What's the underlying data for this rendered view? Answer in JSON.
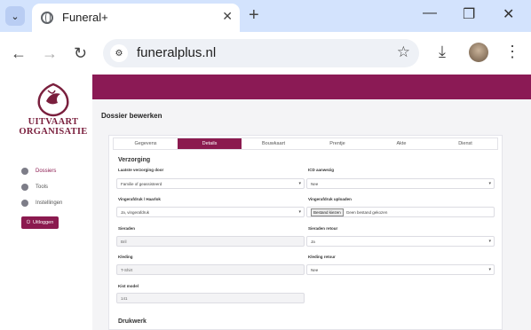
{
  "browser": {
    "tab_title": "Funeral+",
    "url": "funeralplus.nl"
  },
  "sidebar": {
    "logo_line1": "UITVAART",
    "logo_line2": "ORGANISATIE",
    "items": [
      {
        "label": "Dossiers"
      },
      {
        "label": "Tools"
      },
      {
        "label": "Instellingen"
      }
    ],
    "logout_label": "Uitloggen"
  },
  "page": {
    "title": "Dossier bewerken",
    "tabs": [
      "Gegevens",
      "Details",
      "Bouwkaart",
      "Prentje",
      "Akte",
      "Dienst"
    ],
    "active_tab": "Details",
    "section_verzorging": "Verzorging",
    "section_drukwerk": "Drukwerk",
    "fields": {
      "laatste_verzorging_label": "Laatste verzorging door",
      "laatste_verzorging_value": "Familie of geassisteerd",
      "icd_label": "ICD aanwezig",
      "icd_value": "Nee",
      "vingerafdruk_label": "Vingerafdruk / Haarlok",
      "vingerafdruk_value": "Ja, vingerafdruk",
      "vingerafdruk_upload_label": "Vingerafdruk uploaden",
      "file_button": "Bestand kiezen",
      "file_status": "Geen bestand gekozen",
      "sieraden_label": "Sieraden",
      "sieraden_value": "Bril",
      "sieraden_retour_label": "Sieraden retour",
      "sieraden_retour_value": "Ja",
      "kleding_label": "Kleding",
      "kleding_value": "T-Shirt",
      "kleding_retour_label": "Kleding retour",
      "kleding_retour_value": "Nee",
      "kist_label": "Kist model",
      "kist_value": "141"
    }
  },
  "colors": {
    "brand": "#8b1a55",
    "logo": "#7a1f3d",
    "tabstrip": "#d3e3fd"
  }
}
